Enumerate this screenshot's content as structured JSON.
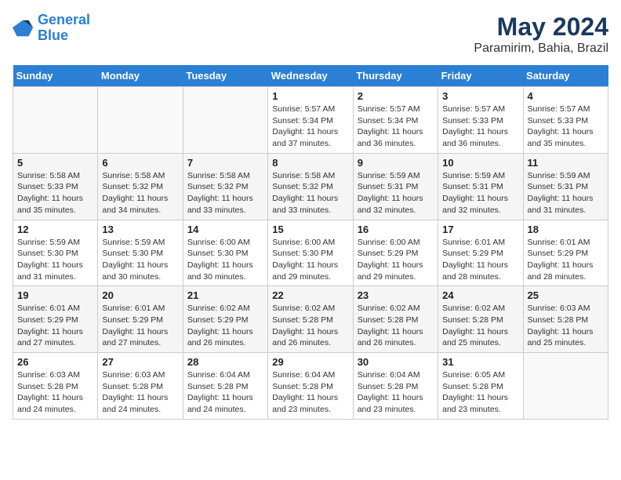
{
  "header": {
    "logo_line1": "General",
    "logo_line2": "Blue",
    "main_title": "May 2024",
    "subtitle": "Paramirim, Bahia, Brazil"
  },
  "weekdays": [
    "Sunday",
    "Monday",
    "Tuesday",
    "Wednesday",
    "Thursday",
    "Friday",
    "Saturday"
  ],
  "weeks": [
    [
      {
        "day": "",
        "info": ""
      },
      {
        "day": "",
        "info": ""
      },
      {
        "day": "",
        "info": ""
      },
      {
        "day": "1",
        "info": "Sunrise: 5:57 AM\nSunset: 5:34 PM\nDaylight: 11 hours\nand 37 minutes."
      },
      {
        "day": "2",
        "info": "Sunrise: 5:57 AM\nSunset: 5:34 PM\nDaylight: 11 hours\nand 36 minutes."
      },
      {
        "day": "3",
        "info": "Sunrise: 5:57 AM\nSunset: 5:33 PM\nDaylight: 11 hours\nand 36 minutes."
      },
      {
        "day": "4",
        "info": "Sunrise: 5:57 AM\nSunset: 5:33 PM\nDaylight: 11 hours\nand 35 minutes."
      }
    ],
    [
      {
        "day": "5",
        "info": "Sunrise: 5:58 AM\nSunset: 5:33 PM\nDaylight: 11 hours\nand 35 minutes."
      },
      {
        "day": "6",
        "info": "Sunrise: 5:58 AM\nSunset: 5:32 PM\nDaylight: 11 hours\nand 34 minutes."
      },
      {
        "day": "7",
        "info": "Sunrise: 5:58 AM\nSunset: 5:32 PM\nDaylight: 11 hours\nand 33 minutes."
      },
      {
        "day": "8",
        "info": "Sunrise: 5:58 AM\nSunset: 5:32 PM\nDaylight: 11 hours\nand 33 minutes."
      },
      {
        "day": "9",
        "info": "Sunrise: 5:59 AM\nSunset: 5:31 PM\nDaylight: 11 hours\nand 32 minutes."
      },
      {
        "day": "10",
        "info": "Sunrise: 5:59 AM\nSunset: 5:31 PM\nDaylight: 11 hours\nand 32 minutes."
      },
      {
        "day": "11",
        "info": "Sunrise: 5:59 AM\nSunset: 5:31 PM\nDaylight: 11 hours\nand 31 minutes."
      }
    ],
    [
      {
        "day": "12",
        "info": "Sunrise: 5:59 AM\nSunset: 5:30 PM\nDaylight: 11 hours\nand 31 minutes."
      },
      {
        "day": "13",
        "info": "Sunrise: 5:59 AM\nSunset: 5:30 PM\nDaylight: 11 hours\nand 30 minutes."
      },
      {
        "day": "14",
        "info": "Sunrise: 6:00 AM\nSunset: 5:30 PM\nDaylight: 11 hours\nand 30 minutes."
      },
      {
        "day": "15",
        "info": "Sunrise: 6:00 AM\nSunset: 5:30 PM\nDaylight: 11 hours\nand 29 minutes."
      },
      {
        "day": "16",
        "info": "Sunrise: 6:00 AM\nSunset: 5:29 PM\nDaylight: 11 hours\nand 29 minutes."
      },
      {
        "day": "17",
        "info": "Sunrise: 6:01 AM\nSunset: 5:29 PM\nDaylight: 11 hours\nand 28 minutes."
      },
      {
        "day": "18",
        "info": "Sunrise: 6:01 AM\nSunset: 5:29 PM\nDaylight: 11 hours\nand 28 minutes."
      }
    ],
    [
      {
        "day": "19",
        "info": "Sunrise: 6:01 AM\nSunset: 5:29 PM\nDaylight: 11 hours\nand 27 minutes."
      },
      {
        "day": "20",
        "info": "Sunrise: 6:01 AM\nSunset: 5:29 PM\nDaylight: 11 hours\nand 27 minutes."
      },
      {
        "day": "21",
        "info": "Sunrise: 6:02 AM\nSunset: 5:29 PM\nDaylight: 11 hours\nand 26 minutes."
      },
      {
        "day": "22",
        "info": "Sunrise: 6:02 AM\nSunset: 5:28 PM\nDaylight: 11 hours\nand 26 minutes."
      },
      {
        "day": "23",
        "info": "Sunrise: 6:02 AM\nSunset: 5:28 PM\nDaylight: 11 hours\nand 26 minutes."
      },
      {
        "day": "24",
        "info": "Sunrise: 6:02 AM\nSunset: 5:28 PM\nDaylight: 11 hours\nand 25 minutes."
      },
      {
        "day": "25",
        "info": "Sunrise: 6:03 AM\nSunset: 5:28 PM\nDaylight: 11 hours\nand 25 minutes."
      }
    ],
    [
      {
        "day": "26",
        "info": "Sunrise: 6:03 AM\nSunset: 5:28 PM\nDaylight: 11 hours\nand 24 minutes."
      },
      {
        "day": "27",
        "info": "Sunrise: 6:03 AM\nSunset: 5:28 PM\nDaylight: 11 hours\nand 24 minutes."
      },
      {
        "day": "28",
        "info": "Sunrise: 6:04 AM\nSunset: 5:28 PM\nDaylight: 11 hours\nand 24 minutes."
      },
      {
        "day": "29",
        "info": "Sunrise: 6:04 AM\nSunset: 5:28 PM\nDaylight: 11 hours\nand 23 minutes."
      },
      {
        "day": "30",
        "info": "Sunrise: 6:04 AM\nSunset: 5:28 PM\nDaylight: 11 hours\nand 23 minutes."
      },
      {
        "day": "31",
        "info": "Sunrise: 6:05 AM\nSunset: 5:28 PM\nDaylight: 11 hours\nand 23 minutes."
      },
      {
        "day": "",
        "info": ""
      }
    ]
  ]
}
